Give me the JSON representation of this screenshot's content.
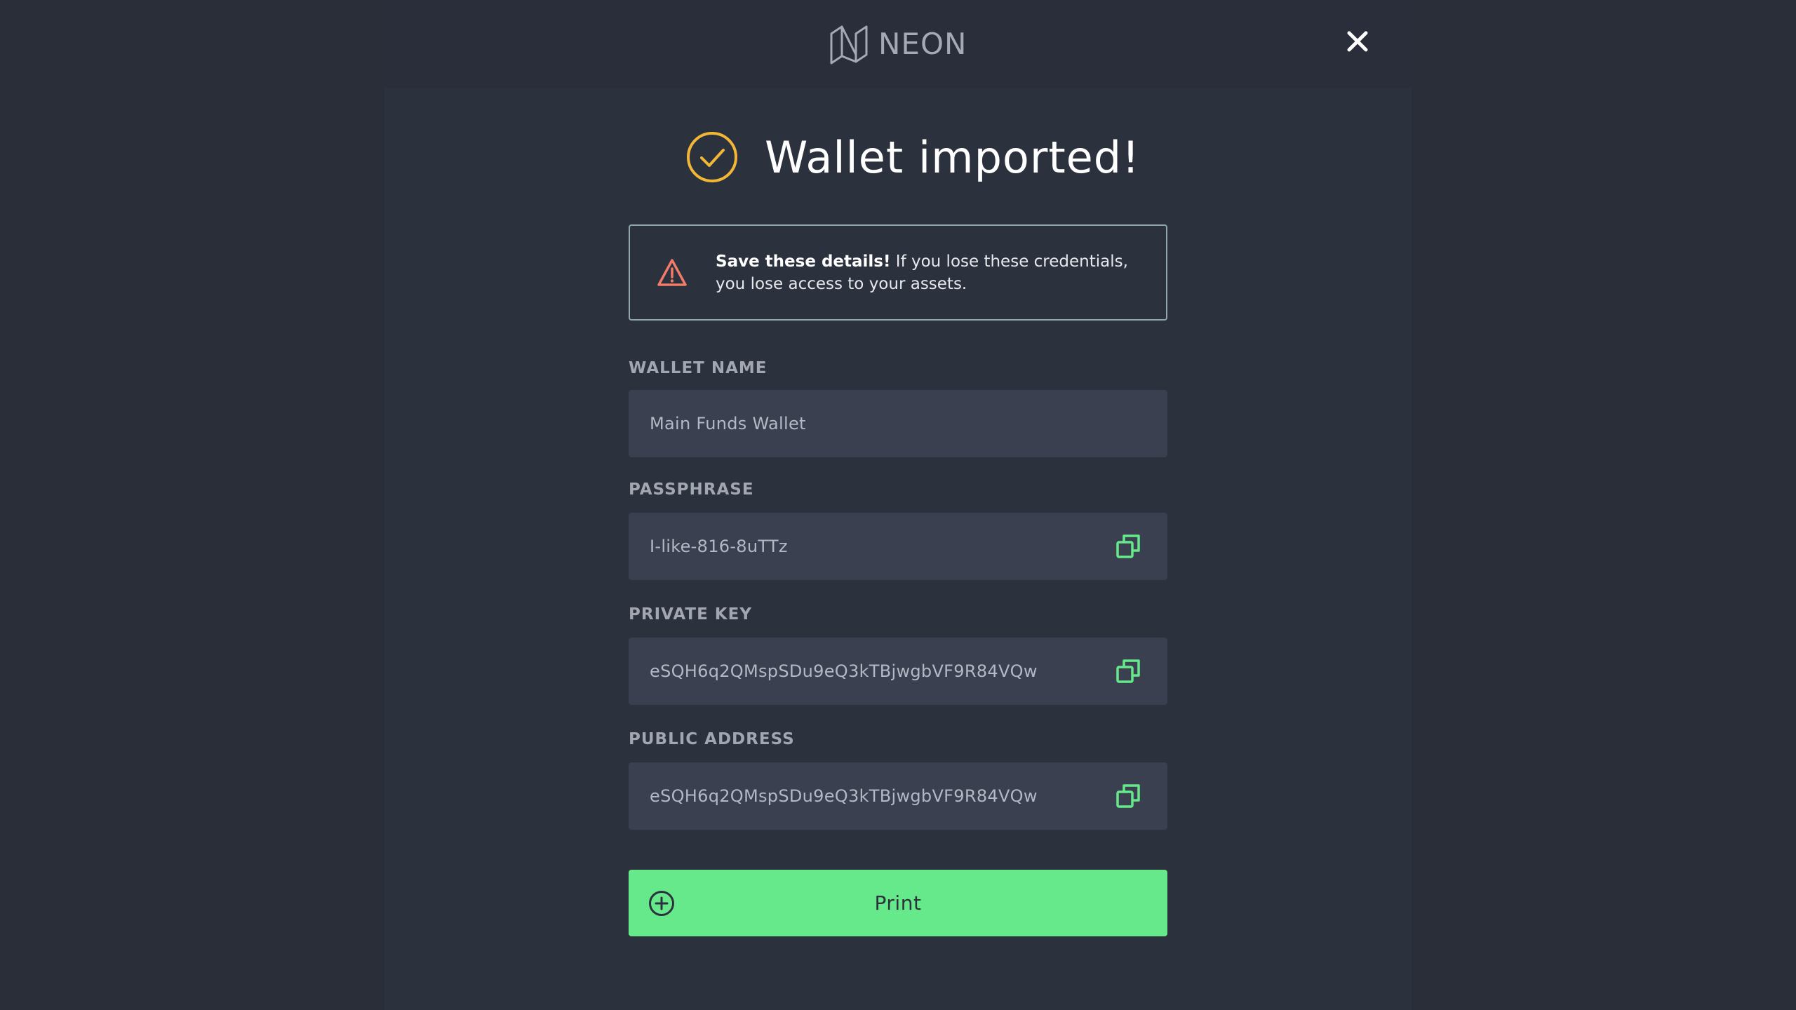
{
  "header": {
    "brand": "NEON",
    "close_icon": "close-icon"
  },
  "title": {
    "icon": "check-circle-icon",
    "text": "Wallet imported!"
  },
  "warning": {
    "icon": "warning-triangle-icon",
    "bold": "Save these details!",
    "message": " If you lose these credentials, you lose access to your assets."
  },
  "fields": {
    "wallet_name": {
      "label": "WALLET NAME",
      "value": "Main Funds Wallet"
    },
    "passphrase": {
      "label": "PASSPHRASE",
      "value": "I-like-816-8uTTz",
      "icon": "copy-icon"
    },
    "private_key": {
      "label": "PRIVATE KEY",
      "value": "eSQH6q2QMspSDu9eQ3kTBjwgbVF9R84VQw",
      "icon": "copy-icon"
    },
    "public_address": {
      "label": "PUBLIC ADDRESS",
      "value": "eSQH6q2QMspSDu9eQ3kTBjwgbVF9R84VQw",
      "icon": "copy-icon"
    }
  },
  "print_button": {
    "label": "Print",
    "icon": "plus-circle-icon"
  },
  "colors": {
    "background": "#292e39",
    "panel": "#2c313e",
    "field": "#3b4051",
    "accent_green": "#66e98a",
    "check_yellow": "#f2b735",
    "warning_red": "#f07b69",
    "warning_border": "#8fa6ad",
    "label_gray": "#a2a6b0"
  }
}
